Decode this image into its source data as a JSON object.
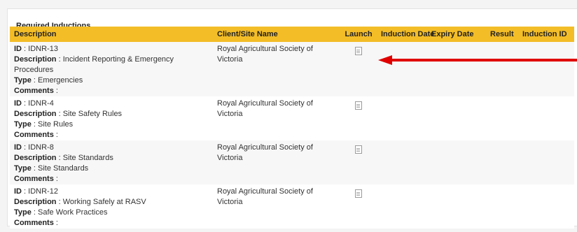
{
  "section": {
    "title": "Required Inductions"
  },
  "table": {
    "headers": {
      "description": "Description",
      "client": "Client/Site Name",
      "launch": "Launch",
      "induction_date": "Induction Date",
      "expiry_date": "Expiry Date",
      "result": "Result",
      "induction_id": "Induction ID"
    },
    "field_labels": {
      "id": "ID",
      "description": "Description",
      "type": "Type",
      "comments": "Comments"
    },
    "rows": [
      {
        "id": "IDNR-13",
        "description": "Incident Reporting & Emergency Procedures",
        "type": "Emergencies",
        "comments": "",
        "client": "Royal Agricultural Society of Victoria",
        "launch_icon": "document-icon"
      },
      {
        "id": "IDNR-4",
        "description": "Site Safety Rules",
        "type": "Site Rules",
        "comments": "",
        "client": "Royal Agricultural Society of Victoria",
        "launch_icon": "document-icon"
      },
      {
        "id": "IDNR-8",
        "description": "Site Standards",
        "type": "Site Standards",
        "comments": "",
        "client": "Royal Agricultural Society of Victoria",
        "launch_icon": "document-icon"
      },
      {
        "id": "IDNR-12",
        "description": "Working Safely at RASV",
        "type": "Safe Work Practices",
        "comments": "",
        "client": "Royal Agricultural Society of Victoria",
        "launch_icon": "document-icon"
      }
    ]
  },
  "colors": {
    "header_bg": "#f3bd27",
    "arrow": "#e00000",
    "row_alt": "#f7f7f7"
  }
}
